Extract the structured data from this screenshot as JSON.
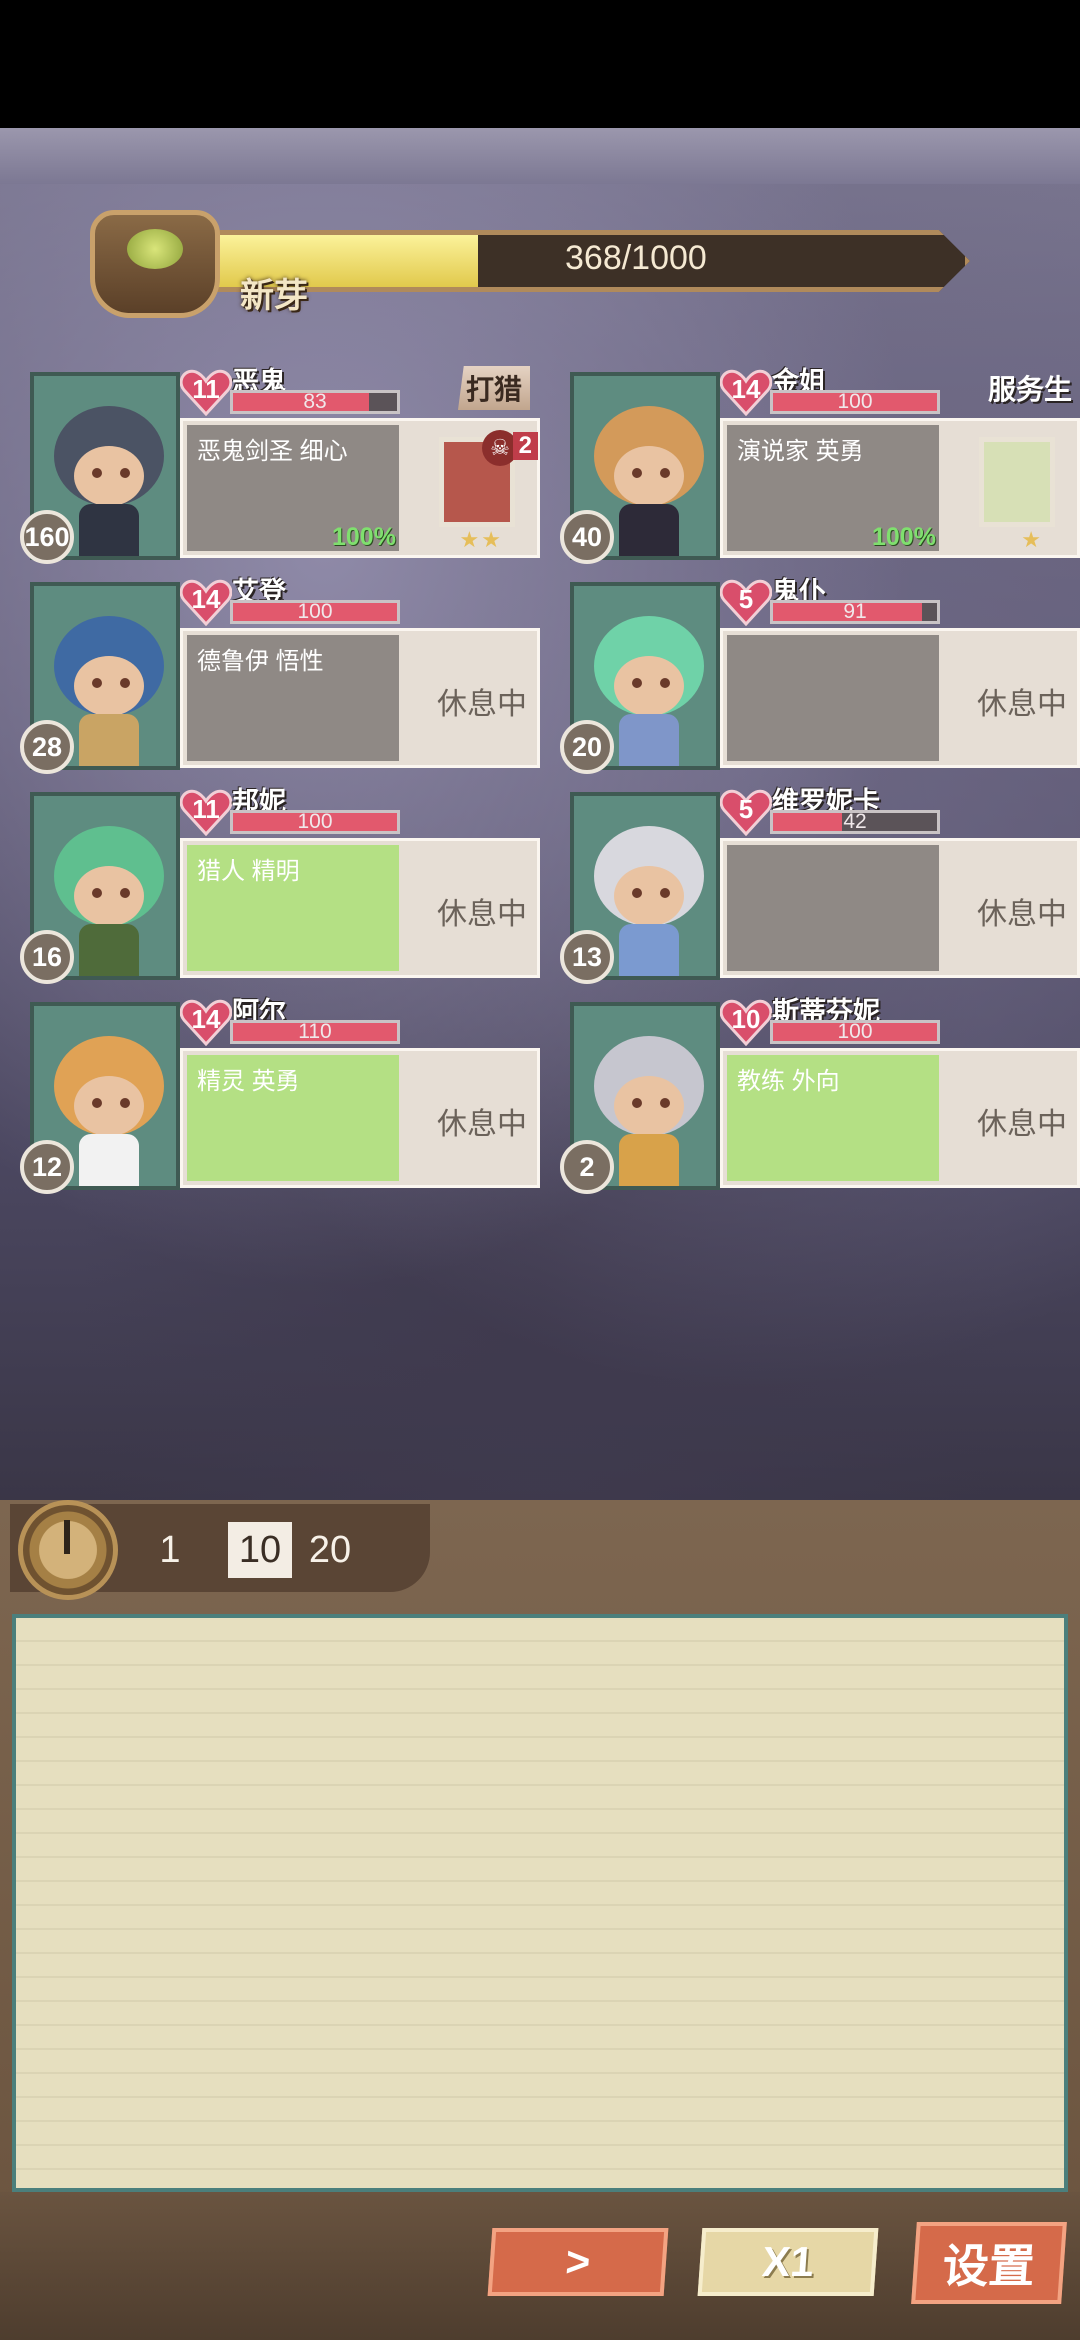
{
  "xp": {
    "rank": "新芽",
    "current": 368,
    "max": 1000,
    "text": "368/1000",
    "fill_fraction": 0.368
  },
  "characters": [
    {
      "name": "恶鬼",
      "level": "160",
      "heart": "11",
      "hp": "83",
      "hp_fraction": 0.83,
      "traits": "恶鬼剑圣  细心",
      "job": "打猎",
      "progress": "100%",
      "skull_count": "2",
      "stars": "★★",
      "state": "working",
      "panel": "gray",
      "hair": "#4b5364",
      "body": "#2f3442"
    },
    {
      "name": "金姐",
      "level": "40",
      "heart": "14",
      "hp": "100",
      "hp_fraction": 1.0,
      "traits": "演说家  英勇",
      "job": "服务生",
      "progress": "100%",
      "skull_count": "",
      "stars": "★",
      "state": "working",
      "panel": "gray",
      "hair": "#d39a5a",
      "body": "#2d2a38"
    },
    {
      "name": "艾登",
      "level": "28",
      "heart": "14",
      "hp": "100",
      "hp_fraction": 1.0,
      "traits": "德鲁伊  悟性",
      "job": "",
      "rest": "休息中",
      "state": "resting",
      "panel": "gray",
      "hair": "#3f6aa3",
      "body": "#c9a464"
    },
    {
      "name": "鬼仆",
      "level": "20",
      "heart": "5",
      "hp": "91",
      "hp_fraction": 0.91,
      "traits": "",
      "job": "",
      "rest": "休息中",
      "state": "resting",
      "panel": "gray",
      "hair": "#6fd2a8",
      "body": "#7f96c9"
    },
    {
      "name": "邦妮",
      "level": "16",
      "heart": "11",
      "hp": "100",
      "hp_fraction": 1.0,
      "traits": "猎人  精明",
      "job": "",
      "rest": "休息中",
      "state": "resting",
      "panel": "green",
      "hair": "#5fbf8f",
      "body": "#4f6b3a"
    },
    {
      "name": "维罗妮卡",
      "level": "13",
      "heart": "5",
      "hp": "42",
      "hp_fraction": 0.42,
      "traits": "",
      "job": "",
      "rest": "休息中",
      "state": "resting",
      "panel": "gray",
      "hair": "#d8d8de",
      "body": "#7b9ad0"
    },
    {
      "name": "阿尔",
      "level": "12",
      "heart": "14",
      "hp": "110",
      "hp_fraction": 1.0,
      "traits": "精灵  英勇",
      "job": "",
      "rest": "休息中",
      "state": "resting",
      "panel": "green",
      "hair": "#e0a255",
      "body": "#f2f2f2"
    },
    {
      "name": "斯蒂芬妮",
      "level": "2",
      "heart": "10",
      "hp": "100",
      "hp_fraction": 1.0,
      "traits": "教练  外向",
      "job": "",
      "rest": "休息中",
      "state": "resting",
      "panel": "green",
      "hair": "#c6c6cf",
      "body": "#d8a24a"
    }
  ],
  "log": {
    "speed_options": [
      "1",
      "10",
      "20"
    ],
    "active_speed": "10"
  },
  "controls": {
    "next_label": ">",
    "speed_label": "X1",
    "settings_label": "设置"
  },
  "colors": {
    "hp": "#e2596d",
    "xp": "#e1c94c",
    "green_panel": "#b4e084"
  }
}
